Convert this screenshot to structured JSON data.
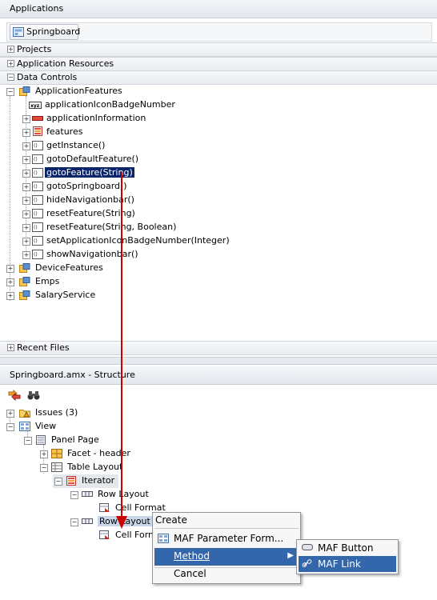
{
  "applications_panel": {
    "title": "Applications",
    "springboard_button": "Springboard",
    "sections": {
      "projects": "Projects",
      "app_resources": "Application Resources",
      "data_controls": "Data Controls",
      "recent_files": "Recent Files"
    }
  },
  "data_tree": {
    "root": "ApplicationFeatures",
    "children": [
      "applicationIconBadgeNumber",
      "applicationInformation",
      "features",
      "getInstance()",
      "gotoDefaultFeature()",
      "gotoFeature(String)",
      "gotoSpringboard()",
      "hideNavigationbar()",
      "resetFeature(String)",
      "resetFeature(String, Boolean)",
      "setApplicationIconBadgeNumber(Integer)",
      "showNavigationbar()"
    ],
    "others": [
      "DeviceFeatures",
      "Emps",
      "SalaryService"
    ]
  },
  "structure_panel": {
    "title": "Springboard.amx - Structure",
    "nodes": {
      "issues": "Issues (3)",
      "view": "View",
      "panel_page": "Panel Page",
      "facet": "Facet - header",
      "table_layout": "Table Layout",
      "iterator": "Iterator",
      "row_layout_1": "Row Layout",
      "cell_format_1": "Cell Format",
      "row_layout_2": "Row Layout",
      "cell_format_2": "Cell Forma"
    }
  },
  "context_menu": {
    "header": "Create",
    "items": [
      "MAF Parameter Form...",
      "Method",
      "Cancel"
    ],
    "submenu": [
      "MAF Button",
      "MAF Link"
    ]
  },
  "colors": {
    "selection": "#0a246a",
    "highlight": "#3366aa",
    "arrow": "#cc0000"
  }
}
